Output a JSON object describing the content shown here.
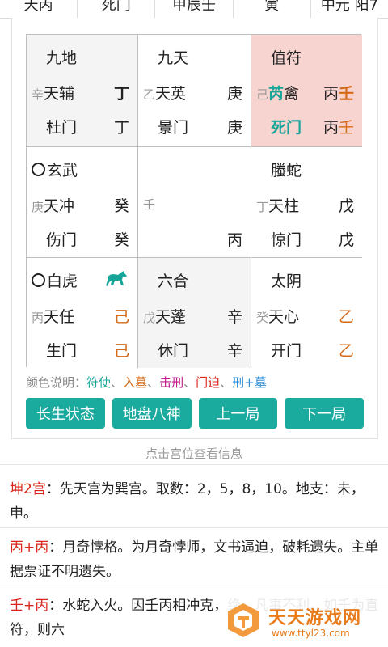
{
  "top_strip": [
    "天丙",
    "死门",
    "甲辰壬",
    "寅",
    "中元 阳7"
  ],
  "palaces": [
    {
      "god": "九地",
      "star_stem": "辛",
      "star": "天辅",
      "sky_stem": "丁",
      "door": "杜门",
      "earth_stem": "丁"
    },
    {
      "god": "九天",
      "star_stem": "乙",
      "star": "天英",
      "sky_stem": "庚",
      "door": "景门",
      "earth_stem": "庚"
    },
    {
      "god": "值符",
      "star_stem": "己",
      "star_a": "芮",
      "star_b": "禽",
      "sky_stem_a": "丙",
      "sky_stem_b": "壬",
      "door": "死门",
      "earth_stem_a": "丙",
      "earth_stem_b": "壬"
    },
    {
      "god": "玄武",
      "star_stem": "庚",
      "star": "天冲",
      "sky_stem": "癸",
      "door": "伤门",
      "earth_stem": "癸"
    },
    {
      "center_stem": "壬",
      "earth_stem": "丙"
    },
    {
      "god": "螣蛇",
      "star_stem": "丁",
      "star": "天柱",
      "sky_stem": "戊",
      "door": "惊门",
      "earth_stem": "戊"
    },
    {
      "god": "白虎",
      "star_stem": "丙",
      "star": "天任",
      "sky_stem": "己",
      "door": "生门",
      "earth_stem": "己"
    },
    {
      "god": "六合",
      "star_stem": "戊",
      "star": "天蓬",
      "sky_stem": "辛",
      "door": "休门",
      "earth_stem": "辛"
    },
    {
      "god": "太阴",
      "star_stem": "癸",
      "star": "天心",
      "sky_stem": "乙",
      "door": "开门",
      "earth_stem": "乙"
    }
  ],
  "legend": {
    "prefix": "颜色说明：",
    "items": [
      "符使",
      "入墓",
      "击刑",
      "门迫",
      "刑+墓"
    ],
    "separator": "、"
  },
  "colors": {
    "teal": "#18a599",
    "orange": "#d46a17",
    "purple": "#c2188b",
    "red": "#d9261c",
    "blue": "#2f8ed4",
    "button": "#1bab9e",
    "highlight": "#f8d4d0"
  },
  "buttons": [
    "长生状态",
    "地盘八神",
    "上一局",
    "下一局"
  ],
  "hint": "点击宫位查看信息",
  "sections": [
    {
      "head": "坤2宫",
      "body": "：先天宫为巽宫。取数：2，5，8，10。地支：未，申。"
    },
    {
      "head": "丙+丙",
      "body": "：月奇悖格。为月奇悖师，文书逼迫，破耗遗失。主单据票证不明遗失。"
    },
    {
      "head": "壬+丙",
      "body": "：水蛇入火。因壬丙相冲克，绝。凡事不利。如壬为直符，则六"
    }
  ],
  "watermark": {
    "name": "天天游戏网",
    "url": "www.ttyl23.com"
  }
}
